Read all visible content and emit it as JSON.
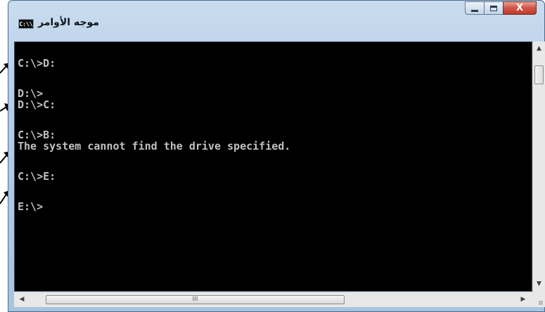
{
  "window": {
    "title": "موجه الأوامر",
    "app_icon": {
      "name": "cmd-app-icon",
      "text": "C:\\\\"
    },
    "controls": {
      "minimize": "minimize-icon",
      "maximize": "maximize-icon",
      "close": "close-icon",
      "close_glyph": "X"
    }
  },
  "console": {
    "lines": [
      "C:\\>D:",
      "D:\\>",
      "D:\\>C:",
      "C:\\>B:",
      "The system cannot find the drive specified.",
      "C:\\>E:",
      "E:\\>"
    ],
    "colors": {
      "background": "#000000",
      "text": "#c0c0c0"
    }
  },
  "scrollbars": {
    "vertical": {
      "up": "▲",
      "down": "▼"
    },
    "horizontal": {
      "left": "◀",
      "right": "▶",
      "thumb_grip": "III"
    }
  },
  "annotations": {
    "arrow_color": "#000000",
    "count": 4
  }
}
